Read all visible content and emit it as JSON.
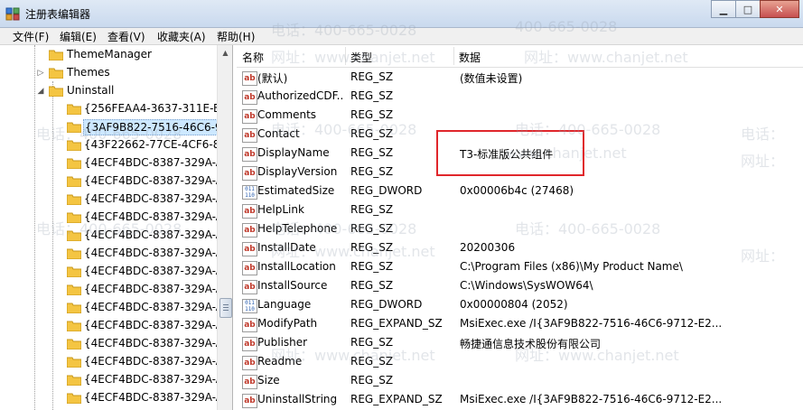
{
  "window": {
    "title": "注册表编辑器",
    "controls": [
      "minimize",
      "maximize",
      "close"
    ]
  },
  "menu": [
    {
      "label": "文件(F)"
    },
    {
      "label": "编辑(E)"
    },
    {
      "label": "查看(V)"
    },
    {
      "label": "收藏夹(A)"
    },
    {
      "label": "帮助(H)"
    }
  ],
  "tree": {
    "items": [
      {
        "label": "ThemeManager",
        "expander": ""
      },
      {
        "label": "Themes",
        "expander": "▷"
      },
      {
        "label": "Uninstall",
        "expander": "◢"
      },
      {
        "label": "{256FEAA4-3637-311E-B4",
        "expander": ""
      },
      {
        "label": "{3AF9B822-7516-46C6-97",
        "expander": ""
      },
      {
        "label": "{43F22662-77CE-4CF6-8E",
        "expander": ""
      },
      {
        "label": "{4ECF4BDC-8387-329A-A",
        "expander": ""
      },
      {
        "label": "{4ECF4BDC-8387-329A-A",
        "expander": ""
      },
      {
        "label": "{4ECF4BDC-8387-329A-A",
        "expander": ""
      },
      {
        "label": "{4ECF4BDC-8387-329A-A",
        "expander": ""
      },
      {
        "label": "{4ECF4BDC-8387-329A-A",
        "expander": ""
      },
      {
        "label": "{4ECF4BDC-8387-329A-A",
        "expander": ""
      },
      {
        "label": "{4ECF4BDC-8387-329A-A",
        "expander": ""
      },
      {
        "label": "{4ECF4BDC-8387-329A-A",
        "expander": ""
      },
      {
        "label": "{4ECF4BDC-8387-329A-A",
        "expander": ""
      },
      {
        "label": "{4ECF4BDC-8387-329A-A",
        "expander": ""
      },
      {
        "label": "{4ECF4BDC-8387-329A-A",
        "expander": ""
      },
      {
        "label": "{4ECF4BDC-8387-329A-A",
        "expander": ""
      },
      {
        "label": "{4ECF4BDC-8387-329A-A",
        "expander": ""
      },
      {
        "label": "{4ECF4BDC-8387-329A-A",
        "expander": ""
      }
    ]
  },
  "values_pane": {
    "columns": {
      "name": "名称",
      "type": "类型",
      "data": "数据"
    },
    "rows": [
      {
        "icon": "string-value-icon",
        "name": "(默认)",
        "type": "REG_SZ",
        "data": "(数值未设置)"
      },
      {
        "icon": "string-value-icon",
        "name": "AuthorizedCDF...",
        "type": "REG_SZ",
        "data": ""
      },
      {
        "icon": "string-value-icon",
        "name": "Comments",
        "type": "REG_SZ",
        "data": ""
      },
      {
        "icon": "string-value-icon",
        "name": "Contact",
        "type": "REG_SZ",
        "data": ""
      },
      {
        "icon": "string-value-icon",
        "name": "DisplayName",
        "type": "REG_SZ",
        "data": "T3-标准版公共组件"
      },
      {
        "icon": "string-value-icon",
        "name": "DisplayVersion",
        "type": "REG_SZ",
        "data": ""
      },
      {
        "icon": "binary-value-icon",
        "name": "EstimatedSize",
        "type": "REG_DWORD",
        "data": "0x00006b4c (27468)"
      },
      {
        "icon": "string-value-icon",
        "name": "HelpLink",
        "type": "REG_SZ",
        "data": ""
      },
      {
        "icon": "string-value-icon",
        "name": "HelpTelephone",
        "type": "REG_SZ",
        "data": ""
      },
      {
        "icon": "string-value-icon",
        "name": "InstallDate",
        "type": "REG_SZ",
        "data": "20200306"
      },
      {
        "icon": "string-value-icon",
        "name": "InstallLocation",
        "type": "REG_SZ",
        "data": "C:\\Program Files (x86)\\My Product Name\\"
      },
      {
        "icon": "string-value-icon",
        "name": "InstallSource",
        "type": "REG_SZ",
        "data": "C:\\Windows\\SysWOW64\\"
      },
      {
        "icon": "binary-value-icon",
        "name": "Language",
        "type": "REG_DWORD",
        "data": "0x00000804 (2052)"
      },
      {
        "icon": "string-value-icon",
        "name": "ModifyPath",
        "type": "REG_EXPAND_SZ",
        "data": "MsiExec.exe /I{3AF9B822-7516-46C6-9712-E2..."
      },
      {
        "icon": "string-value-icon",
        "name": "Publisher",
        "type": "REG_SZ",
        "data": "畅捷通信息技术股份有限公司"
      },
      {
        "icon": "string-value-icon",
        "name": "Readme",
        "type": "REG_SZ",
        "data": ""
      },
      {
        "icon": "string-value-icon",
        "name": "Size",
        "type": "REG_SZ",
        "data": ""
      },
      {
        "icon": "string-value-icon",
        "name": "UninstallString",
        "type": "REG_EXPAND_SZ",
        "data": "MsiExec.exe /I{3AF9B822-7516-46C6-9712-E2..."
      }
    ]
  },
  "watermark": {
    "phone": "电话：400-665-0028",
    "site": "网址：www.chanjet.net",
    "site_short": "网址：www.chanjet.net",
    "phone_short": "电话：400-665-0028",
    "phone_partial": "电话：",
    "site_partial": "网址：",
    "site_domain": "www.chanjet.net",
    "phone_number": "400-665-0028"
  },
  "colors": {
    "highlight_box": "#e0262b",
    "selected_row": "#cde8ff"
  }
}
